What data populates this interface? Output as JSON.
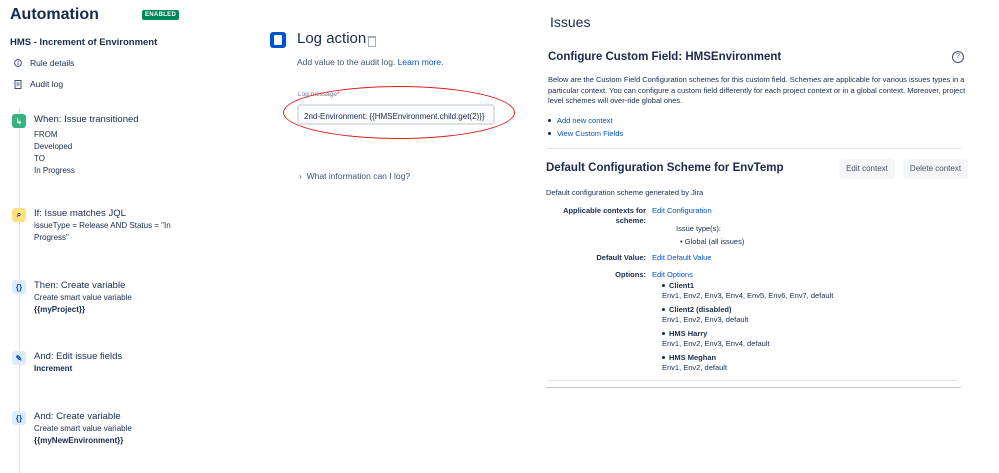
{
  "left": {
    "title": "Automation",
    "badge": "ENABLED",
    "rule_name": "HMS - Increment of Environment",
    "nav": [
      {
        "label": "Rule details"
      },
      {
        "label": "Audit log"
      }
    ],
    "steps": [
      {
        "head": "When: Issue transitioned",
        "lines": [
          "FROM",
          "Developed",
          "TO",
          "In Progress"
        ],
        "color": "#36b37e"
      },
      {
        "head": "If: Issue matches JQL",
        "lines": [
          "issueType = Release AND Status = \"In",
          "Progress\""
        ],
        "color": "#ffc400"
      },
      {
        "head": "Then: Create variable",
        "lines": [
          "Create smart value variable",
          "{{myProject}}"
        ],
        "color": "#0065ff"
      },
      {
        "head": "And: Edit issue fields",
        "lines": [
          "Increment"
        ],
        "color": "#0052cc"
      },
      {
        "head": "And: Create variable",
        "lines": [
          "Create smart value variable",
          "{{myNewEnvironment}}"
        ],
        "color": "#0065ff"
      }
    ]
  },
  "middle": {
    "title": "Log action",
    "subtitle": "Add value to the audit log.",
    "learn_more": "Learn more.",
    "field_label": "Log message",
    "field_required": "*",
    "field_value": "2nd-Environment: {{HMSEnvironment.child.get(2)}}",
    "what_info": "What information can I log?"
  },
  "right": {
    "heading": "Issues",
    "config_title": "Configure Custom Field: HMSEnvironment",
    "description": "Below are the Custom Field Configuration schemes for this custom field. Schemes are applicable for various issues types in a particular context. You can configure a custom field differently for each project context or in a global context. Moreover, project level schemes will over-ride global ones.",
    "links": [
      "Add new context",
      "View Custom Fields"
    ],
    "scheme_title": "Default Configuration Scheme for EnvTemp",
    "buttons": {
      "edit": "Edit context",
      "delete": "Delete context"
    },
    "generated": "Default configuration scheme generated by Jira",
    "applicable_label": "Applicable contexts for scheme:",
    "edit_configuration": "Edit Configuration",
    "issue_types_label": "Issue type(s):",
    "issue_types_value": "Global (all issues)",
    "default_value_label": "Default Value:",
    "edit_default_value": "Edit Default Value",
    "options_label": "Options:",
    "edit_options": "Edit Options",
    "options": [
      {
        "name": "Client1",
        "values": "Env1, Env2, Env3, Env4, Env5, Env6, Env7, default"
      },
      {
        "name": "Client2 (disabled)",
        "values": "Env1, Env2, Env3, default"
      },
      {
        "name": "HMS Harry",
        "values": "Env1, Env2, Env3, Env4, default"
      },
      {
        "name": "HMS Meghan",
        "values": "Env1, Env2, default"
      }
    ]
  },
  "colors": {
    "annotation": "#e01b1b",
    "enabled": "#00875a",
    "link": "#0052cc"
  }
}
